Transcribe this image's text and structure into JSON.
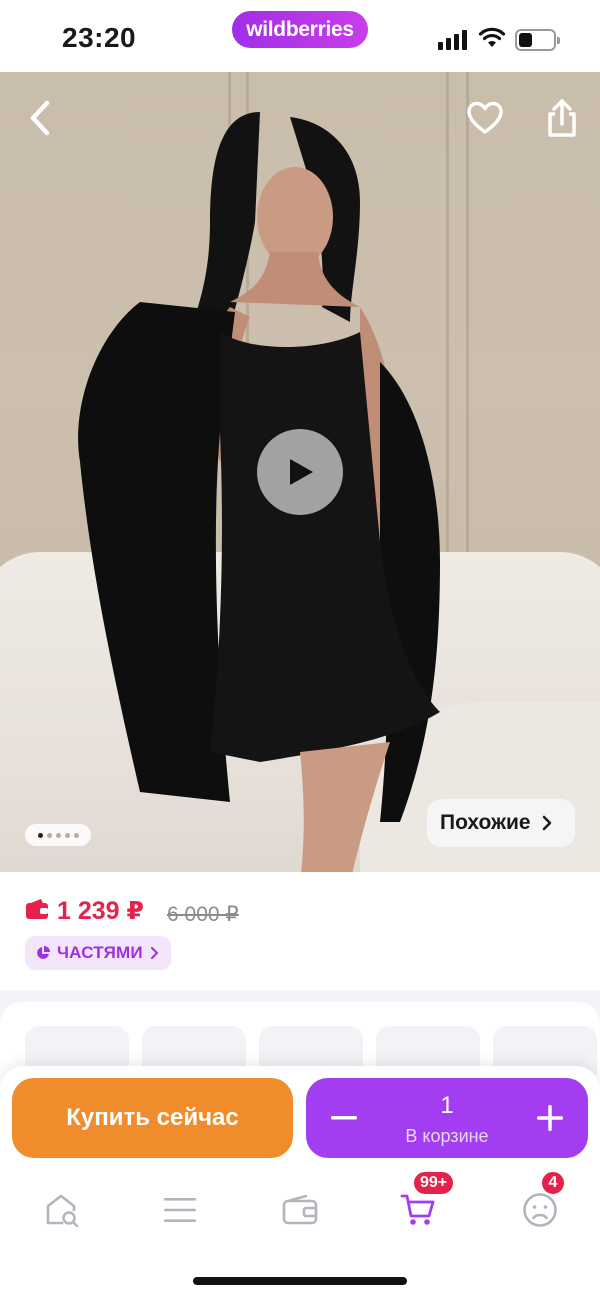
{
  "status_bar": {
    "time": "23:20",
    "brand": "wildberries",
    "battery_level": 0.4
  },
  "hero": {
    "gallery_total": 5,
    "gallery_active_index": 0,
    "similar_label": "Похожие",
    "icons": [
      "chevron-left-icon",
      "heart-icon",
      "share-icon",
      "play-icon",
      "chevron-right-icon"
    ]
  },
  "price": {
    "current": "1 239 ₽",
    "old": "6 000 ₽",
    "installments_label": "ЧАСТЯМИ",
    "accent_color": "#e5224e"
  },
  "actions": {
    "buy_now_label": "Купить сейчас",
    "quantity": "1",
    "in_cart_label": "В корзине",
    "buy_color": "#f08c2c",
    "cart_color": "#a33df2"
  },
  "tabbar": {
    "items": [
      {
        "name": "home-search",
        "icon": "home-search-icon"
      },
      {
        "name": "catalog",
        "icon": "menu-icon"
      },
      {
        "name": "wallet",
        "icon": "wallet-icon"
      },
      {
        "name": "cart",
        "icon": "cart-icon",
        "badge": "99+"
      },
      {
        "name": "profile",
        "icon": "profile-icon",
        "badge": "4"
      }
    ]
  }
}
